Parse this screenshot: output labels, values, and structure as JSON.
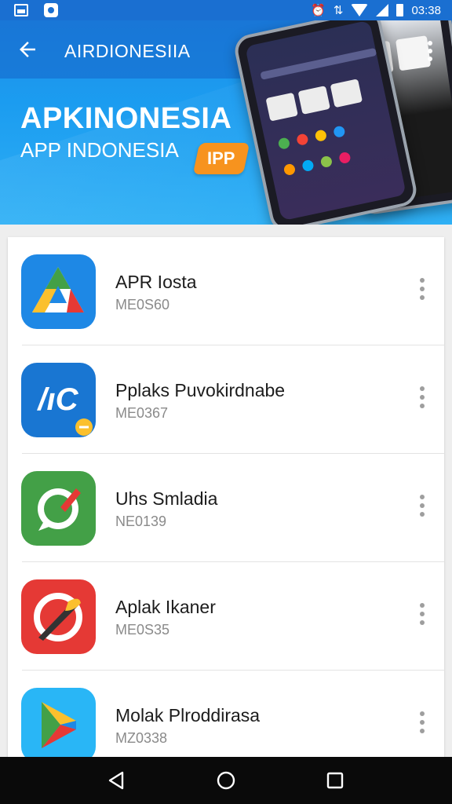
{
  "status_bar": {
    "time": "03:38",
    "icons": [
      "image-icon",
      "app-notification-icon",
      "alarm-icon",
      "data-icon",
      "wifi-icon",
      "signal-icon",
      "battery-icon"
    ],
    "color": "#1a6fd1"
  },
  "toolbar": {
    "title": "AIRDIONESIIA"
  },
  "banner": {
    "brand_title": "APKINONESIA",
    "brand_subtitle": "APP INDONESIA",
    "tag": "IPP",
    "tag_color": "#f7931e"
  },
  "apps": [
    {
      "name": "APR Iosta",
      "meta": "ME0S60",
      "icon": "triangle-logo-icon"
    },
    {
      "name": "Pplaks Puvokirdnabe",
      "meta": "ME0367",
      "icon": "ac-logo-icon"
    },
    {
      "name": "Uhs Smladia",
      "meta": "NE0139",
      "icon": "chat-pencil-icon"
    },
    {
      "name": "Aplak Ikaner",
      "meta": "ME0S35",
      "icon": "feather-circle-icon"
    },
    {
      "name": "Molak Plroddirasa",
      "meta": "MZ0338",
      "icon": "play-store-icon"
    }
  ],
  "nav": {
    "back": "back-nav-icon",
    "home": "home-nav-icon",
    "recents": "recents-nav-icon"
  },
  "colors": {
    "header": "#1f8ee8",
    "card": "#ffffff",
    "nav": "#0a0a0a"
  }
}
